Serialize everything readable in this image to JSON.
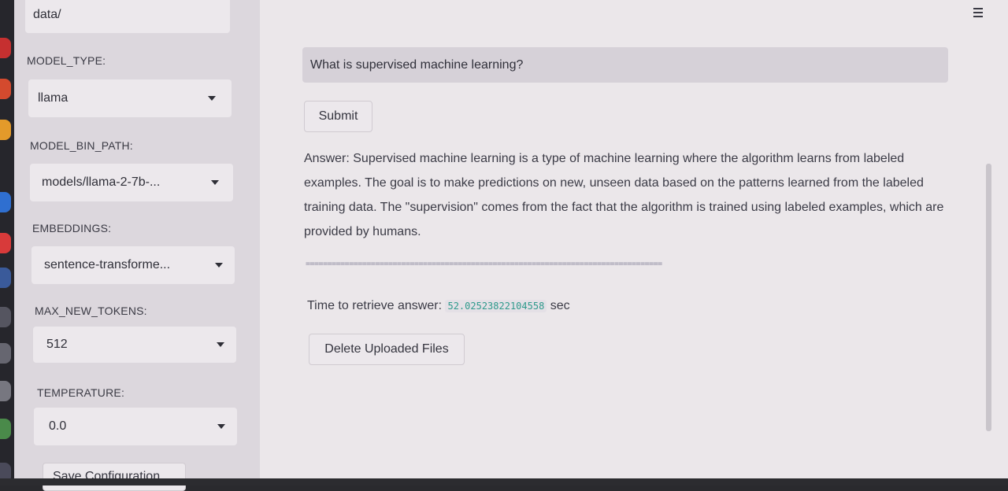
{
  "sidebar": {
    "folder_value": "data/",
    "model_type": {
      "label": "MODEL_TYPE:",
      "value": "llama"
    },
    "model_bin_path": {
      "label": "MODEL_BIN_PATH:",
      "value": "models/llama-2-7b-..."
    },
    "embeddings": {
      "label": "EMBEDDINGS:",
      "value": "sentence-transforme..."
    },
    "max_new_tokens": {
      "label": "MAX_NEW_TOKENS:",
      "value": "512"
    },
    "temperature": {
      "label": "TEMPERATURE:",
      "value": "0.0"
    },
    "save_button": "Save Configuration"
  },
  "main": {
    "question": "What is supervised machine learning?",
    "submit_button": "Submit",
    "answer": "Answer: Supervised machine learning is a type of machine learning where the algorithm learns from labeled examples. The goal is to make predictions on new, unseen data based on the patterns learned from the labeled training data. The \"supervision\" comes from the fact that the algorithm is trained using labeled examples, which are provided by humans.",
    "divider": "==================================================================================",
    "time_label": "Time to retrieve answer:",
    "time_value": "52.02523822104558",
    "time_unit": "sec",
    "delete_button": "Delete Uploaded Files"
  },
  "icons": {
    "menu": "hamburger-menu-icon",
    "dropdown": "caret-down-icon"
  },
  "colors": {
    "sidebar_bg": "#dcd7dd",
    "main_bg": "#ebe7ea",
    "code_text": "#2f9a8c"
  }
}
